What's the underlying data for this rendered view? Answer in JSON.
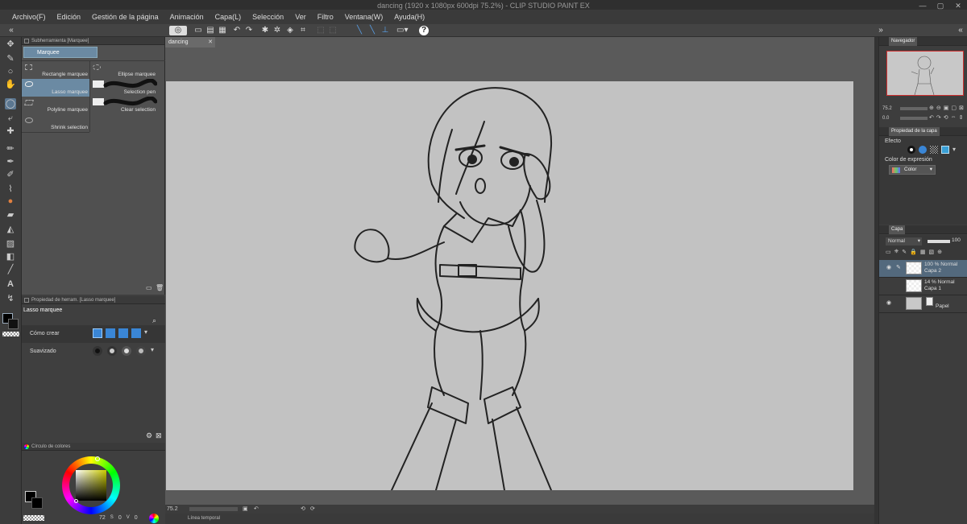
{
  "window": {
    "title": "dancing (1920 x 1080px 600dpi 75.2%)  - CLIP STUDIO PAINT EX"
  },
  "menu": [
    "Archivo(F)",
    "Edición",
    "Gestión de la página",
    "Animación",
    "Capa(L)",
    "Selección",
    "Ver",
    "Filtro",
    "Ventana(W)",
    "Ayuda(H)"
  ],
  "subtool": {
    "header": "Subherramienta [Marquee]",
    "tab": "Marquee",
    "items": [
      "Rectangle marquee",
      "Ellipse marquee",
      "Lasso marquee",
      "Selection pen",
      "Polyline marquee",
      "Clear selection",
      "Shrink selection"
    ]
  },
  "toolprop": {
    "header": "Propiedad de herram. [Lasso marquee]",
    "tool_name": "Lasso marquee",
    "rows": [
      "Cómo crear",
      "Suavizado"
    ]
  },
  "color": {
    "header": "Círculo de colores",
    "values": [
      "72",
      "0",
      "0"
    ],
    "main_color": "#000000",
    "sub_color": "#ffffff"
  },
  "document": {
    "tab": "dancing",
    "zoom": "75.2"
  },
  "timeline": {
    "label": "Línea temporal"
  },
  "navigator": {
    "header": "Navegador",
    "zoom": "75.2",
    "angle": "0.0"
  },
  "layerprop": {
    "header": "Propiedad de la capa",
    "effect_label": "Efecto",
    "expr_label": "Color de expresión",
    "expr_value": "Color"
  },
  "layers": {
    "tab": "Capa",
    "blend_mode": "Normal",
    "opacity": "100",
    "items": [
      {
        "opacity": "100 % Normal",
        "name": "Capa 2"
      },
      {
        "opacity": "14 % Normal",
        "name": "Capa 1"
      },
      {
        "opacity": "",
        "name": "Papel"
      }
    ]
  },
  "colors": {
    "selection": "#6b8aa3",
    "paper": "#c2c2c2",
    "nav_border": "#d03030"
  }
}
